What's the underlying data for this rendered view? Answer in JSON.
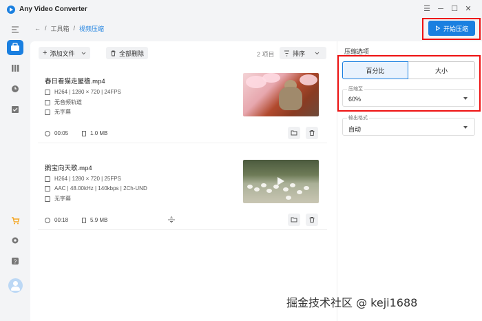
{
  "app": {
    "title": "Any Video Converter"
  },
  "window_controls": {
    "menu": "☰",
    "minimize": "─",
    "maximize": "☐",
    "close": "✕"
  },
  "breadcrumb": {
    "back": "←",
    "sep1": "/",
    "root": "工具箱",
    "sep2": "/",
    "current": "视频压缩"
  },
  "start_button": {
    "label": "开始压缩"
  },
  "toolbar": {
    "add_label": "添加文件",
    "delete_all_label": "全部删除",
    "count": "2 项目",
    "sort_label": "排序"
  },
  "files": [
    {
      "name": "春日看猫走屋檐.mp4",
      "video": "H264 | 1280 × 720 | 24FPS",
      "audio": "无音频轨道",
      "subtitle": "无字幕",
      "duration": "00:05",
      "size": "1.0 MB"
    },
    {
      "name": "鹅宝向天歌.mp4",
      "video": "H264 | 1280 × 720 | 25FPS",
      "audio": "AAC | 48.00kHz | 140kbps | 2Ch-UND",
      "subtitle": "无字幕",
      "duration": "00:18",
      "size": "5.9 MB"
    }
  ],
  "panel": {
    "title": "压缩选项",
    "mode_percent": "百分比",
    "mode_size": "大小",
    "compress_label": "压缩至",
    "compress_value": "60%",
    "format_label": "输出格式",
    "format_value": "自动"
  },
  "watermark": "掘金技术社区 @ keji1688",
  "colors": {
    "accent": "#1a7fe0",
    "highlight_box": "#e11111"
  }
}
